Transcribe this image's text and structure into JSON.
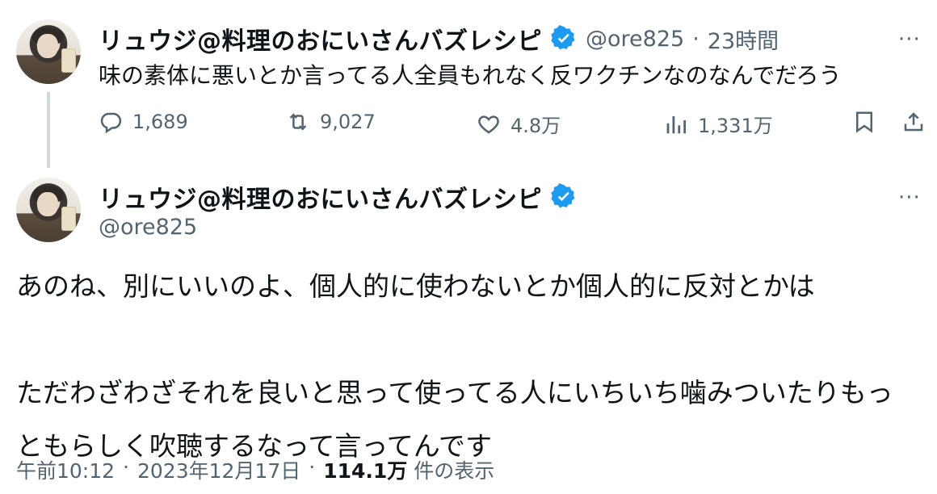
{
  "reply_tweet": {
    "display_name": "リュウジ@料理のおにいさんバズレシピ",
    "handle": "@ore825",
    "separator": "·",
    "time_ago": "23時間",
    "more_label": "···",
    "text": "味の素体に悪いとか言ってる人全員もれなく反ワクチンなのなんでだろう",
    "stats": {
      "replies": "1,689",
      "retweets": "9,027",
      "likes": "4.8万",
      "views": "1,331万"
    }
  },
  "main_tweet": {
    "display_name": "リュウジ@料理のおにいさんバズレシピ",
    "handle": "@ore825",
    "more_label": "···",
    "text": "あのね、別にいいのよ、個人的に使わないとか個人的に反対とかは\n\nただわざわざそれを良いと思って使ってる人にいちいち噛みついたりもっ\nともらしく吹聴するなって言ってんです",
    "time": "午前10:12",
    "dot1": "·",
    "date": "2023年12月17日",
    "dot2": "·",
    "views_count": "114.1万",
    "views_label": "件の表示"
  },
  "colors": {
    "verified": "#1d9bf0",
    "secondary_text": "#536471",
    "thread_line": "#cfd9de"
  },
  "icons": {
    "reply": "reply-icon",
    "retweet": "retweet-icon",
    "like": "heart-icon",
    "views": "views-chart-icon",
    "bookmark": "bookmark-icon",
    "share": "share-icon",
    "verified": "verified-badge-icon"
  }
}
